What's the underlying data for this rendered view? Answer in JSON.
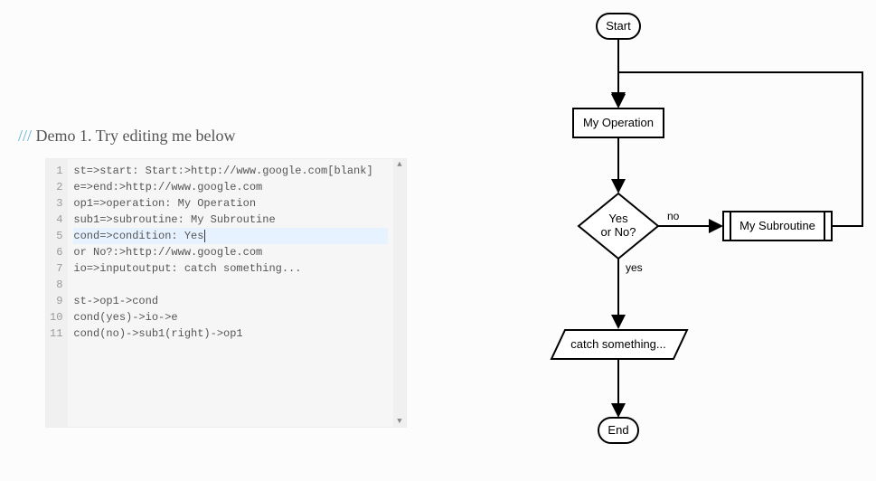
{
  "title": {
    "slashes": "///",
    "text": " Demo 1. Try editing me below"
  },
  "editor": {
    "lines": [
      "st=>start: Start:>http://www.google.com[blank]",
      "e=>end:>http://www.google.com",
      "op1=>operation: My Operation",
      "sub1=>subroutine: My Subroutine",
      "cond=>condition: Yes",
      "or No?:>http://www.google.com",
      "io=>inputoutput: catch something...",
      "",
      "st->op1->cond",
      "cond(yes)->io->e",
      "cond(no)->sub1(right)->op1"
    ],
    "highlightLine": 5,
    "lineNumbers": [
      "1",
      "2",
      "3",
      "4",
      "5",
      "6",
      "7",
      "8",
      "9",
      "10",
      "11"
    ]
  },
  "flowchart": {
    "start": "Start",
    "operation": "My Operation",
    "conditionL1": "Yes",
    "conditionL2": "or No?",
    "yesLabel": "yes",
    "noLabel": "no",
    "subroutine": "My Subroutine",
    "io": "catch something...",
    "end": "End"
  }
}
